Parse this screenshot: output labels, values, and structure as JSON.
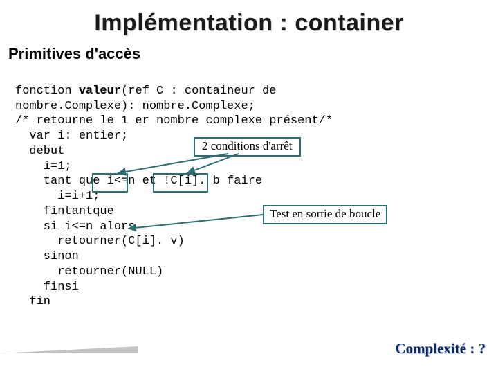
{
  "title": "Implémentation : container",
  "subtitle": "Primitives d'accès",
  "code": {
    "l1a": "fonction ",
    "l1b": "valeur",
    "l1c": "(ref C : containeur de",
    "l2": "nombre.Complexe): nombre.Complexe;",
    "l3": "/* retourne le 1 er nombre complexe présent/*",
    "l4": "  var i: entier;",
    "l5": "  debut",
    "l6": "    i=1;",
    "l7": "    tant que i<=n et !C[i]. b faire",
    "l8": "      i=i+1;",
    "l9": "    fintantque",
    "l10": "    si i<=n alors",
    "l11": "      retourner(C[i]. v)",
    "l12": "    sinon",
    "l13": "      retourner(NULL)",
    "l14": "    finsi",
    "l15": "  fin"
  },
  "callouts": {
    "top": "2 conditions d'arrêt",
    "right": "Test en sortie de boucle"
  },
  "complexity": "Complexité : ?"
}
